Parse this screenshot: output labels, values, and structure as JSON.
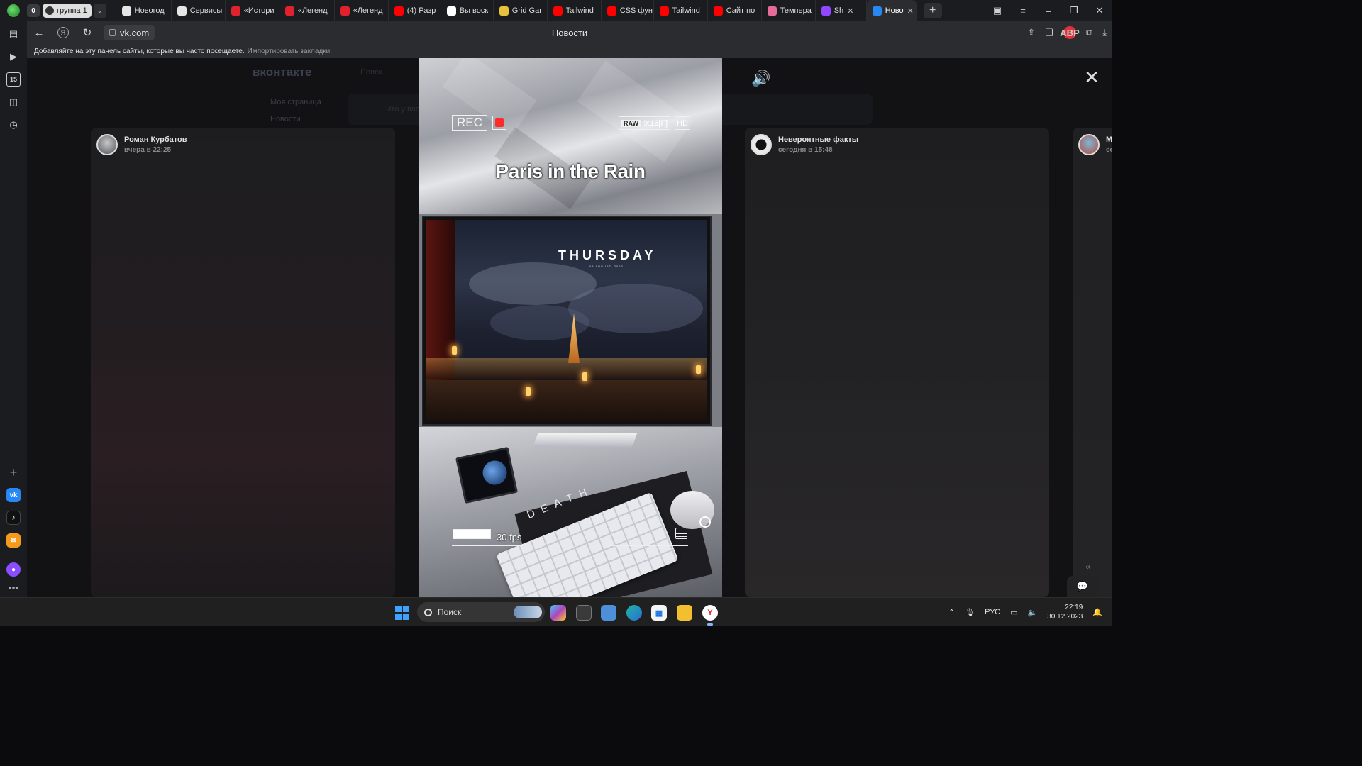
{
  "colors": {
    "accent_vk": "#2787f5",
    "record_red": "#ff2a2a",
    "tab_bar_bg": "#1b1c1f",
    "omnibox_bg": "#2b2c30",
    "taskbar_bg": "#202020"
  },
  "tabbar": {
    "tab_count": "0",
    "group_label": "группа 1",
    "tabs": [
      {
        "label": "Новогод",
        "icon": "bar-chart-icon",
        "color": "#e6e6e6"
      },
      {
        "label": "Сервисы",
        "icon": "bar-chart-icon",
        "color": "#e6e6e6"
      },
      {
        "label": "«Истори",
        "icon": "red-square-icon",
        "color": "#e1222c"
      },
      {
        "label": "«Легенд",
        "icon": "red-square-icon",
        "color": "#e1222c"
      },
      {
        "label": "«Легенд",
        "icon": "red-square-icon",
        "color": "#e1222c"
      },
      {
        "label": "(4) Разр",
        "icon": "youtube-icon",
        "color": "#ff0000"
      },
      {
        "label": "Вы воск",
        "icon": "notion-icon",
        "color": "#ffffff"
      },
      {
        "label": "Grid Gar",
        "icon": "frog-icon",
        "color": "#e7c23c"
      },
      {
        "label": "Tailwind",
        "icon": "youtube-icon",
        "color": "#ff0000"
      },
      {
        "label": "CSS фун",
        "icon": "youtube-icon",
        "color": "#ff0000"
      },
      {
        "label": "Tailwind",
        "icon": "youtube-icon",
        "color": "#ff0000"
      },
      {
        "label": "Сайт по",
        "icon": "youtube-icon",
        "color": "#ff0000"
      },
      {
        "label": "Темпера",
        "icon": "flower-icon",
        "color": "#e86a9a"
      },
      {
        "label": "Sh",
        "icon": "twitch-icon",
        "color": "#9146ff"
      },
      {
        "label": "Ново",
        "icon": "vk-icon",
        "color": "#2787f5"
      }
    ],
    "close_glyph": "✕",
    "new_tab_glyph": "+"
  },
  "window": {
    "minimize": "–",
    "maximize": "❐",
    "close": "✕",
    "menu": "≡",
    "collections": "▣"
  },
  "omnibox": {
    "back": "←",
    "ya": "Я",
    "reload": "↻",
    "url": "vk.com",
    "page_title": "Новости",
    "abp": "ABP"
  },
  "bookmarks_bar": {
    "hint": "Добавляйте на эту панель сайты, которые вы часто посещаете.",
    "import_link": "Импортировать закладки"
  },
  "background_page": {
    "logo": "вконтакте",
    "search_placeholder": "Поиск",
    "menu": [
      "Моя страница",
      "Новости"
    ],
    "composer_placeholder": "Что у вас нового?"
  },
  "viewer": {
    "left_card": {
      "author": "Роман Курбатов",
      "time": "вчера в 22:25"
    },
    "right_card": {
      "author": "Невероятные факты",
      "time": "сегодня в 15:48"
    },
    "far_card": {
      "author": "М",
      "time": "се"
    },
    "video": {
      "rec_label": "REC",
      "raw_label": "RAW",
      "format_label": "9:16[F]",
      "hd_label": "HD",
      "title": "Paris in the Rain",
      "thursday": "THURSDAY",
      "date_line": "03 AUGUST, 2023",
      "keyboard_text": "DEATH",
      "fps": "30 fps"
    },
    "volume_glyph": "🔊",
    "close_glyph": "✕",
    "chevron_glyph": "«",
    "chat_glyph": "💬"
  },
  "taskbar": {
    "search_placeholder": "Поиск",
    "language": "РУС",
    "time": "22:19",
    "date": "30.12.2023",
    "apps": [
      "copilot-icon",
      "task-view-icon",
      "gallery-icon",
      "edge-icon",
      "store-icon",
      "explorer-icon",
      "yandex-browser-icon"
    ]
  }
}
